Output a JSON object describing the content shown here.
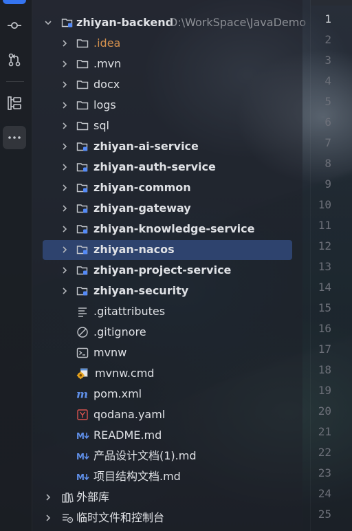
{
  "activity_bar": {
    "items": [
      {
        "name": "commit-icon"
      },
      {
        "name": "pull-requests-icon"
      },
      {
        "name": "structure-icon"
      },
      {
        "name": "more-icon"
      }
    ]
  },
  "project": {
    "root": {
      "label": "zhiyan-backend",
      "path": "D:\\WorkSpace\\JavaDemo"
    },
    "items": [
      {
        "label": ".idea"
      },
      {
        "label": ".mvn"
      },
      {
        "label": "docx"
      },
      {
        "label": "logs"
      },
      {
        "label": "sql"
      },
      {
        "label": "zhiyan-ai-service"
      },
      {
        "label": "zhiyan-auth-service"
      },
      {
        "label": "zhiyan-common"
      },
      {
        "label": "zhiyan-gateway"
      },
      {
        "label": "zhiyan-knowledge-service"
      },
      {
        "label": "zhiyan-nacos"
      },
      {
        "label": "zhiyan-project-service"
      },
      {
        "label": "zhiyan-security"
      },
      {
        "label": ".gitattributes"
      },
      {
        "label": ".gitignore"
      },
      {
        "label": "mvnw"
      },
      {
        "label": "mvnw.cmd"
      },
      {
        "label": "pom.xml"
      },
      {
        "label": "qodana.yaml"
      },
      {
        "label": "README.md"
      },
      {
        "label": "产品设计文档(1).md"
      },
      {
        "label": "项目结构文档.md"
      }
    ],
    "external_libraries": "外部库",
    "scratches": "临时文件和控制台"
  },
  "gutter": {
    "line_numbers": [
      "1",
      "2",
      "3",
      "4",
      "5",
      "6",
      "7",
      "8",
      "9",
      "10",
      "11",
      "12",
      "13",
      "14",
      "15",
      "16",
      "17",
      "18",
      "19",
      "20",
      "21",
      "22",
      "23",
      "24",
      "25"
    ]
  },
  "colors": {
    "accent": "#3574f0",
    "selection": "#2e436e",
    "folder_module_badge": "#548af7",
    "ignored_folder": "#d6924e"
  }
}
